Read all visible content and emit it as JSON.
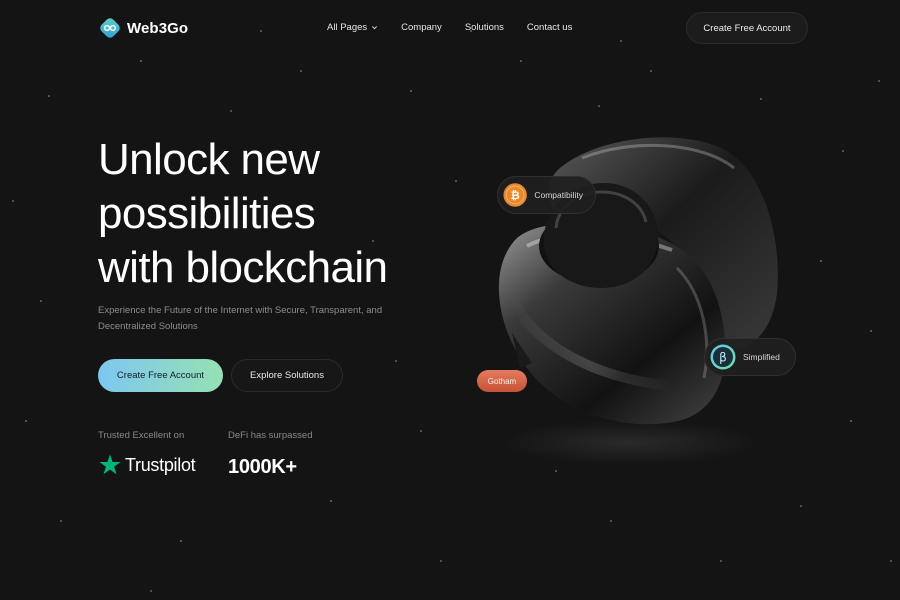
{
  "brand": {
    "name": "Web3Go"
  },
  "nav": {
    "items": [
      {
        "label": "All Pages",
        "has_dropdown": true
      },
      {
        "label": "Company"
      },
      {
        "label": "Solutions"
      },
      {
        "label": "Contact us"
      }
    ],
    "cta_label": "Create Free Account"
  },
  "hero": {
    "title_lines": [
      "Unlock new",
      "possibilities",
      "with blockchain"
    ],
    "subtitle": "Experience the Future of the Internet with Secure, Transparent, and Decentralized Solutions",
    "primary_cta": "Create Free Account",
    "secondary_cta": "Explore Solutions"
  },
  "stats": {
    "trust_label": "Trusted Excellent on",
    "trust_brand": "Trustpilot",
    "defi_label": "DeFi has surpassed",
    "defi_value": "1000K+"
  },
  "badges": {
    "compatibility": "Compatibility",
    "simplified": "Simplified",
    "gotham": "Gotham"
  },
  "icons": {
    "logo": "web3go-logo-icon",
    "bitcoin": "bitcoin-icon",
    "simplified": "b-coin-icon",
    "trustpilot": "trustpilot-star-icon",
    "dropdown": "chevron-down-icon"
  },
  "colors": {
    "background": "#141414",
    "accent_gradient_start": "#7dc7f2",
    "accent_gradient_end": "#96e0b3",
    "trustpilot_green": "#00b67a",
    "bitcoin_orange": "#e8892a",
    "gotham_red": "#d25d40"
  }
}
